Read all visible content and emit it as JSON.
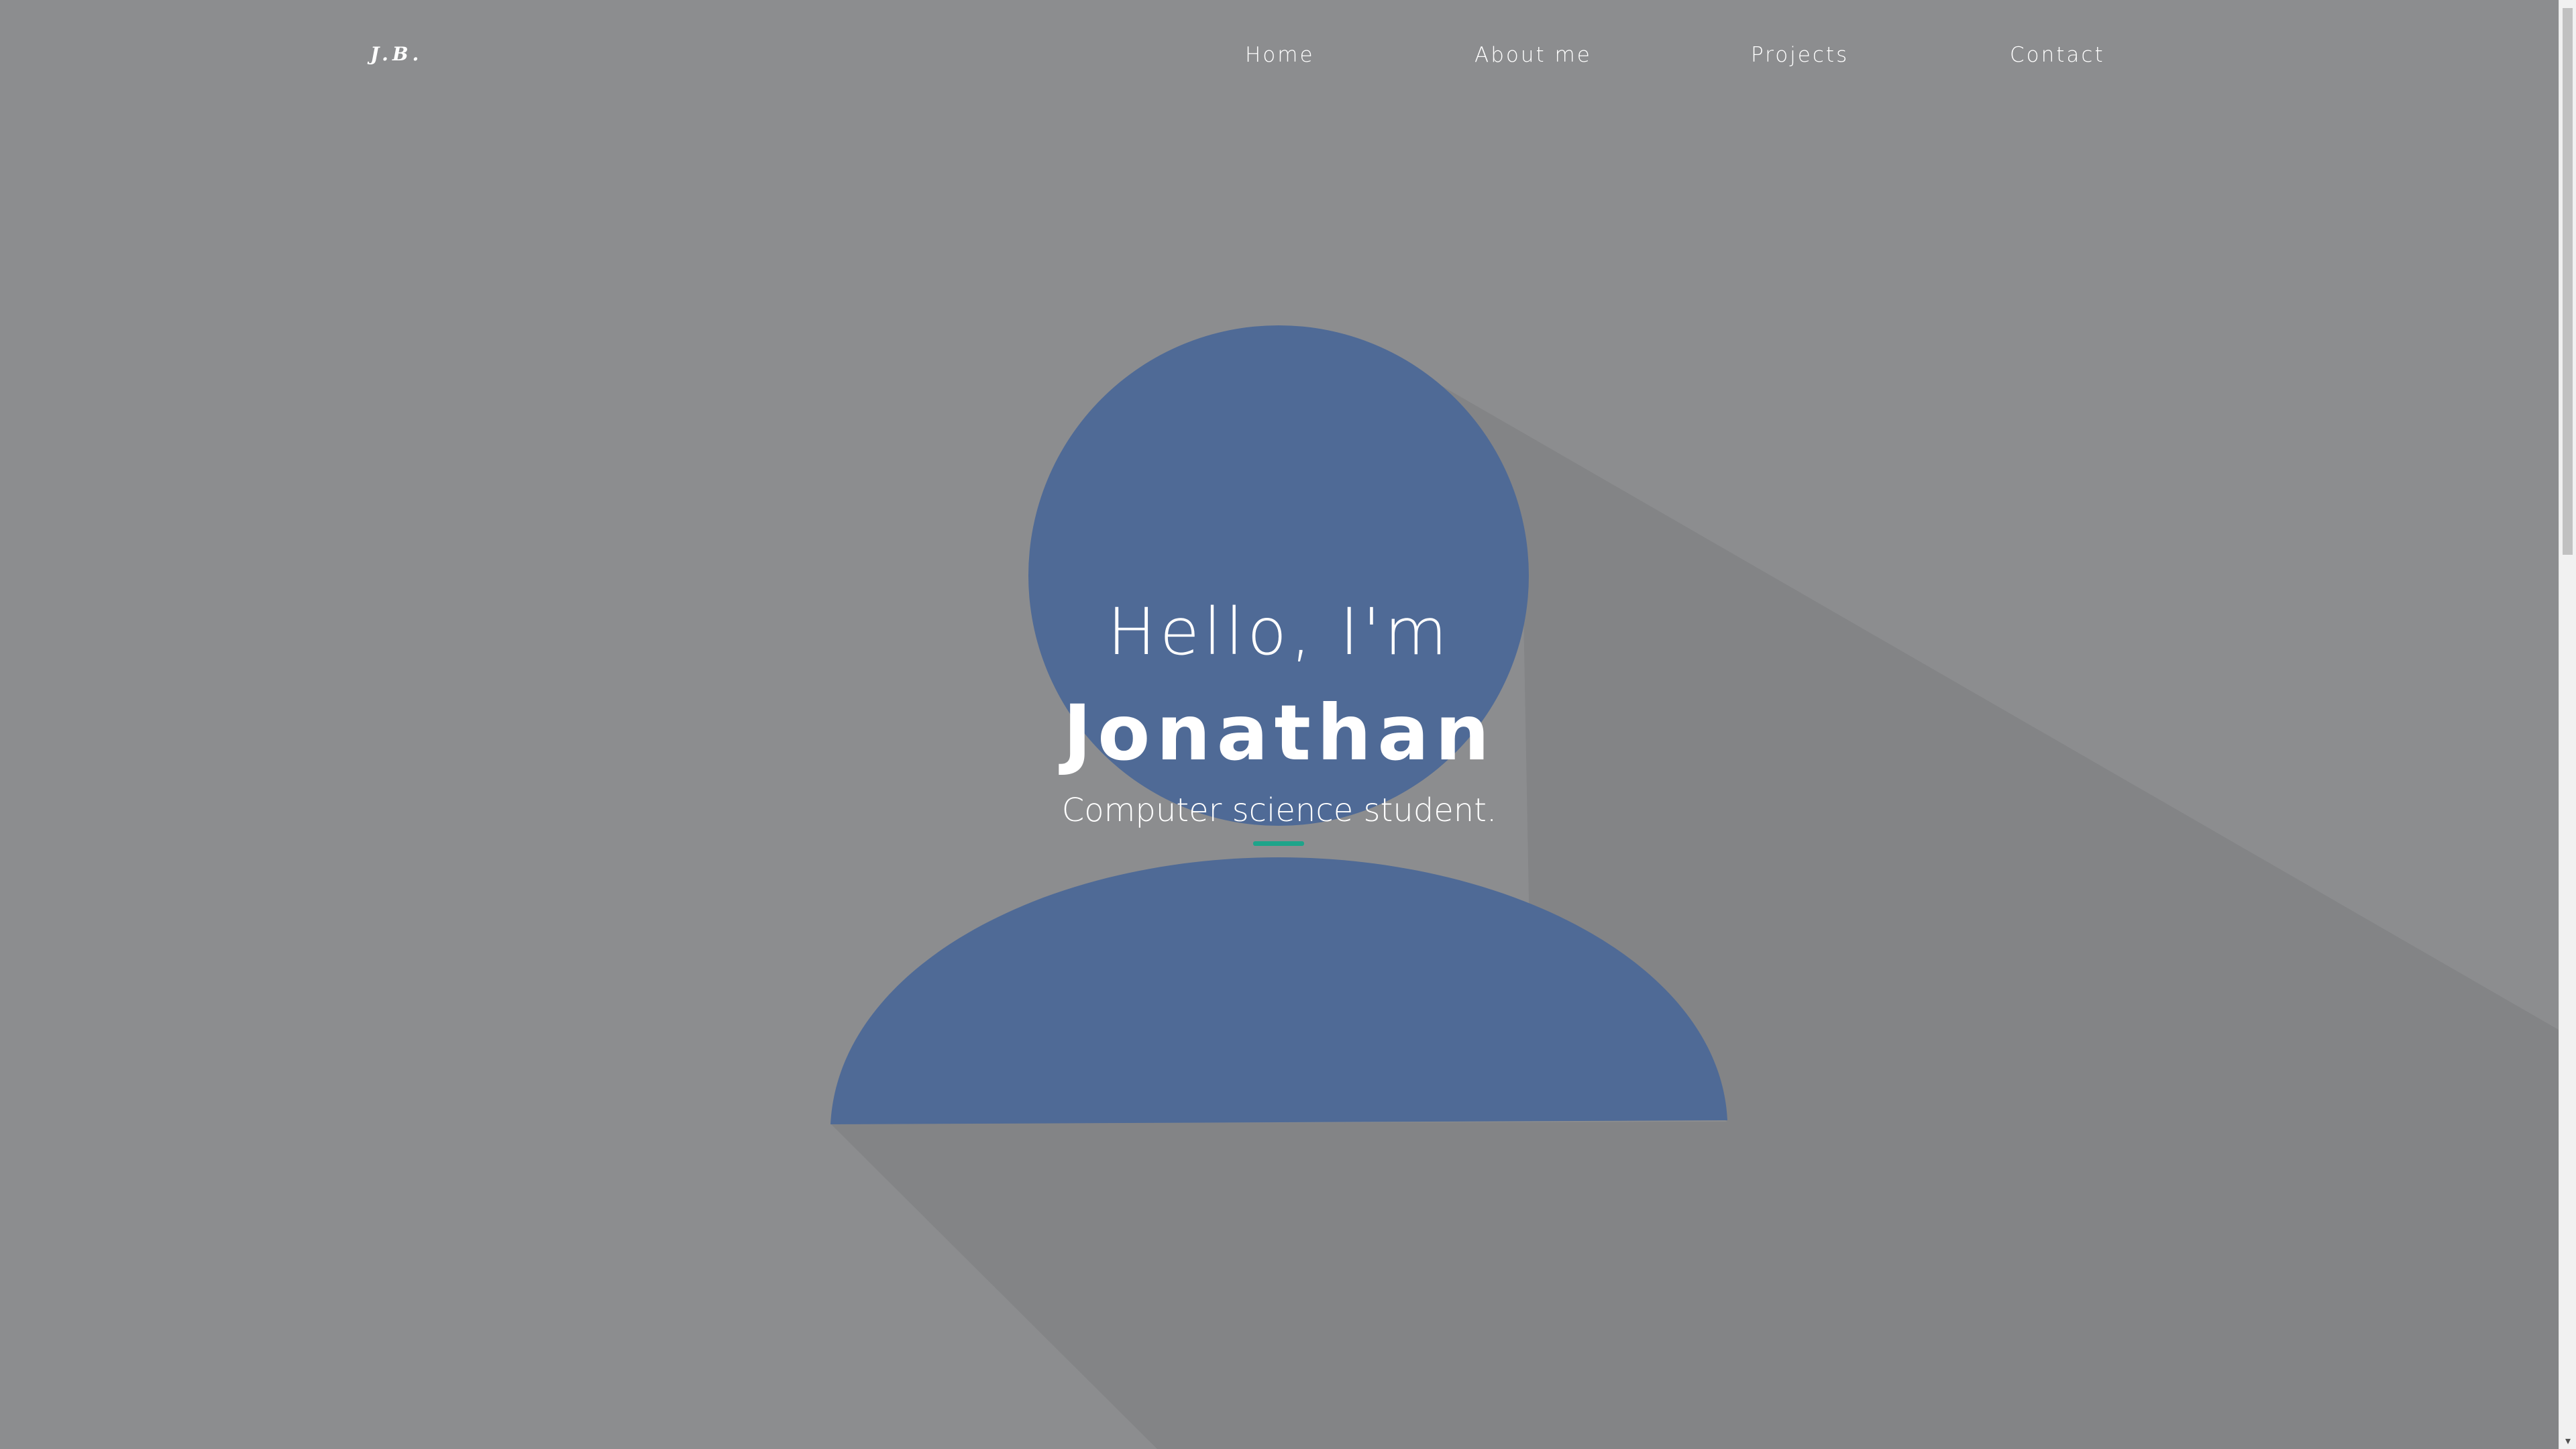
{
  "logo": {
    "text": "J.B."
  },
  "nav": {
    "items": [
      {
        "label": "Home"
      },
      {
        "label": "About me"
      },
      {
        "label": "Projects"
      },
      {
        "label": "Contact"
      }
    ]
  },
  "hero": {
    "greeting": "Hello, I'm",
    "name": "Jonathan",
    "tagline": "Computer science student."
  },
  "scrollbar": {
    "down_arrow": "▾"
  },
  "colors": {
    "background": "#8c8d8f",
    "shadow": "#838486",
    "avatar": "#4f6a96",
    "accent": "#1ea48a",
    "text": "#ffffff"
  },
  "icons": {
    "avatar": "user-silhouette-icon"
  }
}
